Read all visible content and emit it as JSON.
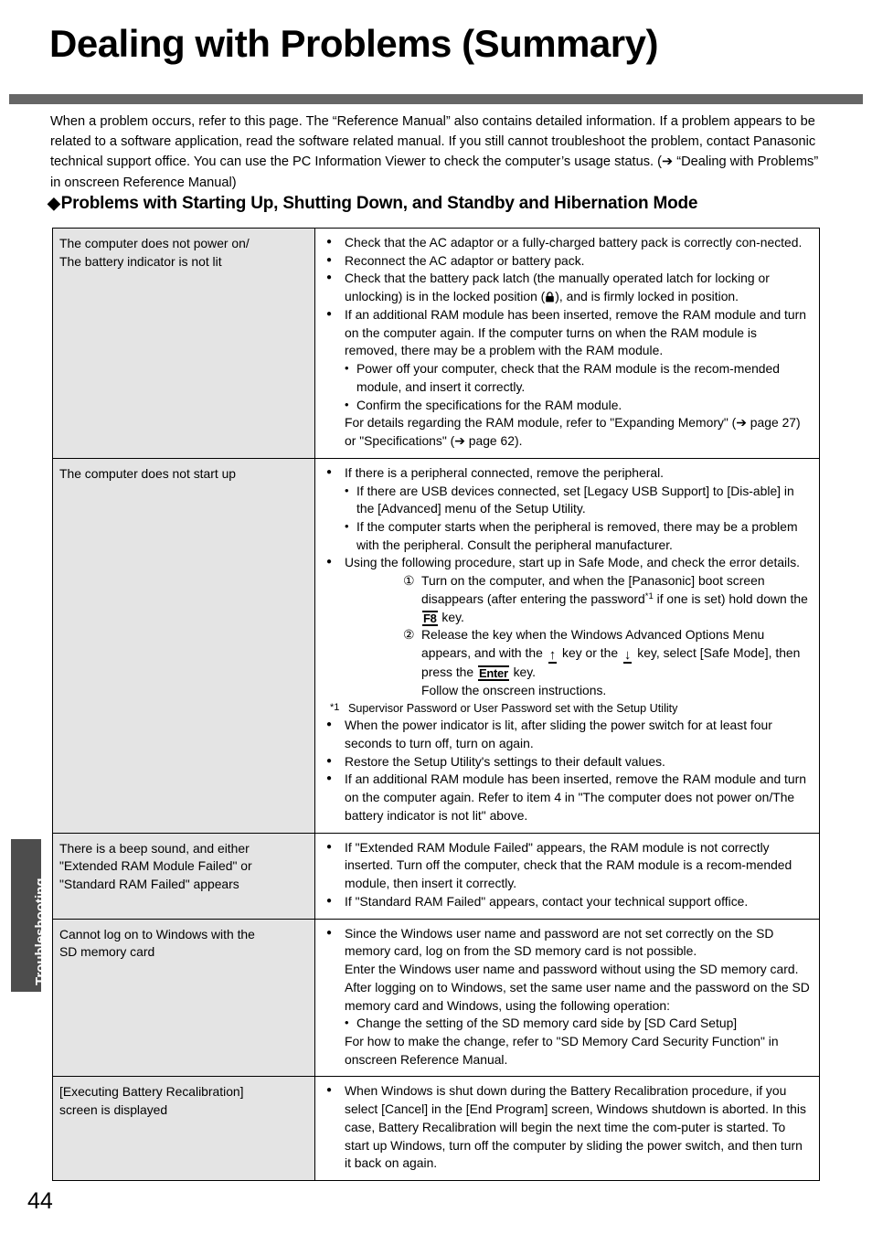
{
  "page": {
    "title": "Dealing with Problems (Summary)",
    "number": "44",
    "side_tab": "Troubleshooting",
    "intro": "When a problem occurs, refer to this page. The “Reference Manual” also contains detailed information. If a problem appears to be related to a software application, read the software related manual. If you still cannot troubleshoot the problem, contact Panasonic technical support office. You can use the PC Information Viewer to check the computer’s usage status. (➔ “Dealing with Problems” in onscreen Reference Manual)",
    "section_heading": "Problems with Starting Up, Shutting Down, and Standby and Hibernation Mode",
    "section_bullet": "◆"
  },
  "table": {
    "rows": [
      {
        "symptom": [
          "The computer does not power on/",
          "The battery indicator is not lit"
        ],
        "fix": {
          "b1": "Check that the AC adaptor or a fully-charged battery pack is correctly con-nected.",
          "b2": "Reconnect the AC adaptor or battery pack.",
          "b3a": "Check that the battery pack latch (the manually operated latch for locking or unlocking) is in the locked position (",
          "b3b": "), and is firmly locked in position.",
          "b4": "If an additional RAM module has been inserted, remove the RAM module and turn on the computer again. If the computer turns on when the RAM module is removed, there may be a problem with the RAM module.",
          "b4s1": "Power off your computer, check that the RAM module is the recom-mended module, and insert it correctly.",
          "b4s2": "Confirm the specifications for the RAM module.",
          "b4c": "For details regarding the RAM module, refer to \"Expanding Memory\" (➔ page 27) or \"Specifications\" (➔ page 62)."
        }
      },
      {
        "symptom": [
          "The computer does not start up"
        ],
        "fix": {
          "b1": "If there is a peripheral connected, remove the peripheral.",
          "b1s1": "If there are USB devices connected, set [Legacy USB Support] to [Dis-able] in the [Advanced] menu of the Setup Utility.",
          "b1s2": "If the computer starts when the peripheral is removed, there may be a problem with the peripheral. Consult the peripheral manufacturer.",
          "b2": "Using the following procedure, start up in Safe Mode, and check the error details.",
          "step1_num": "①",
          "step1a": "Turn on the computer, and when the [Panasonic] boot screen disappears (after entering the password",
          "step1_sup": "*1",
          "step1b": " if one is set) hold down the ",
          "step1_key": "F8",
          "step1c": " key.",
          "step2_num": "②",
          "step2a": "Release the key when the Windows Advanced Options Menu appears, and with the ",
          "step2_key_up": "↑",
          "step2b": " key or the ",
          "step2_key_down": "↓",
          "step2c": " key, select [Safe Mode], then press the ",
          "step2_key_enter": "Enter",
          "step2d": " key.",
          "step2e": "Follow the onscreen instructions.",
          "fn_mark": "*1",
          "fn_text": "Supervisor Password or User Password set with the Setup Utility",
          "b3": "When the power indicator is lit, after sliding the power switch for at least four seconds to turn off, turn on again.",
          "b4": "Restore the Setup Utility's settings to their default values.",
          "b5": "If an additional RAM module has been inserted, remove the RAM module and turn on the computer again. Refer to item 4 in \"The computer does not power on/The battery indicator is not lit\" above."
        }
      },
      {
        "symptom": [
          "There is a beep sound, and either",
          "\"Extended RAM Module Failed\" or",
          "\"Standard RAM Failed\" appears"
        ],
        "fix": {
          "b1": "If \"Extended RAM Module Failed\" appears, the RAM module is not correctly inserted. Turn off the computer, check that the RAM module is a recom-mended module, then insert it correctly.",
          "b2": "If \"Standard RAM Failed\" appears, contact your technical support office."
        }
      },
      {
        "symptom": [
          "Cannot log on to Windows with the",
          "SD memory card"
        ],
        "fix": {
          "b1": "Since the Windows user name and password are not set correctly on the SD memory card, log on from the SD memory card is not possible.",
          "b1c1": "Enter the Windows user name and password without using the SD memory card.",
          "b1c2": "After logging on to Windows, set the same user name and the password on the SD memory card and Windows, using the following operation:",
          "b1s1": "Change the setting of the SD memory card side by [SD Card Setup]",
          "b1c3": "For how to make the change, refer to \"SD Memory Card Security Function\" in onscreen Reference Manual."
        }
      },
      {
        "symptom": [
          "[Executing Battery Recalibration]",
          "screen is displayed"
        ],
        "fix": {
          "b1": "When Windows is shut down during the Battery Recalibration procedure, if you select [Cancel] in the [End Program] screen, Windows shutdown is aborted. In this case, Battery Recalibration will begin the next time the com-puter is started. To start up Windows, turn off the computer by sliding the power switch, and then turn it back on again."
        }
      }
    ]
  }
}
